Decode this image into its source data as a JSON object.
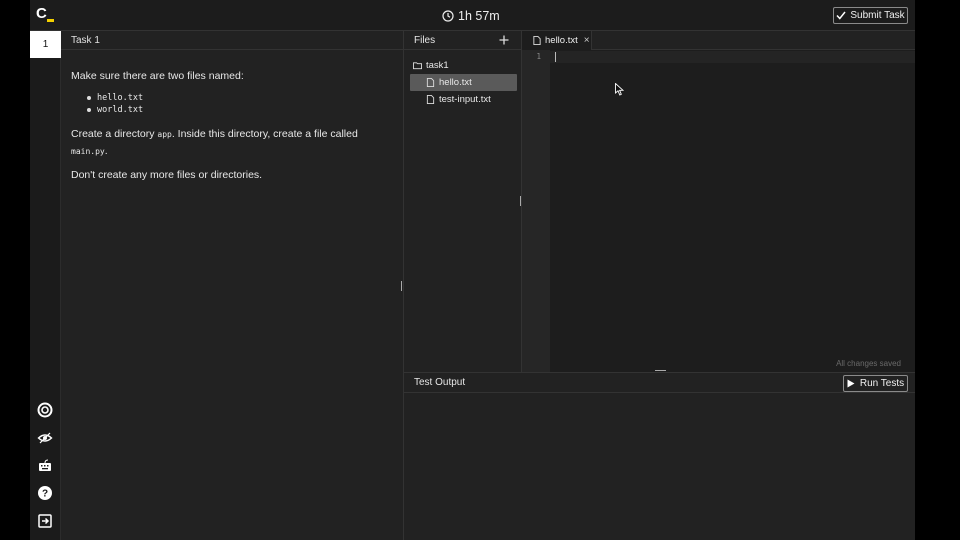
{
  "header": {
    "timer": "1h 57m",
    "submit_label": "Submit Task",
    "accent_color": "#f3d000"
  },
  "rail": {
    "task_number": "1",
    "icons": [
      "settings-icon",
      "eye-icon",
      "keyboard-icon",
      "help-icon",
      "logout-icon"
    ]
  },
  "task": {
    "title": "Task 1",
    "intro": "Make sure there are two files named:",
    "files": [
      "hello.txt",
      "world.txt"
    ],
    "dir_text_1": "Create a directory ",
    "dir_name": "app",
    "dir_text_2": ". Inside this directory, create a file called",
    "dir_file": "main.py",
    "dir_text_3": ".",
    "closing": "Don't create any more files or directories."
  },
  "files_panel": {
    "title": "Files",
    "folder": "task1",
    "items": [
      {
        "name": "hello.txt",
        "selected": true
      },
      {
        "name": "test-input.txt",
        "selected": false
      }
    ]
  },
  "editor": {
    "tab_label": "hello.txt",
    "close_glyph": "×",
    "line_number": "1",
    "status": "All changes saved"
  },
  "test_output": {
    "title": "Test Output",
    "run_label": "Run Tests"
  }
}
